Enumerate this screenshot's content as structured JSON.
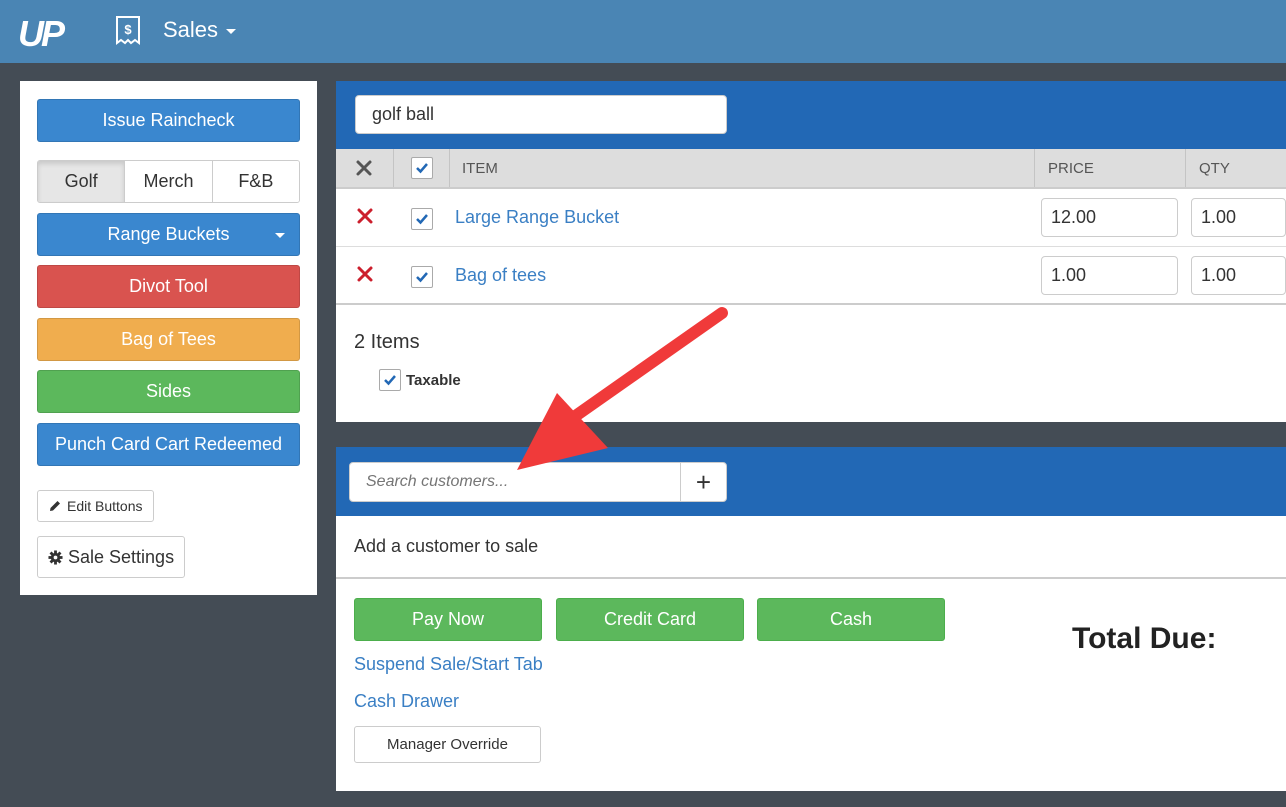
{
  "header": {
    "app_logo_text": "UP",
    "menu_label": "Sales"
  },
  "left_panel": {
    "issue_raincheck": "Issue Raincheck",
    "categories": [
      {
        "label": "Golf",
        "active": true
      },
      {
        "label": "Merch",
        "active": false
      },
      {
        "label": "F&B",
        "active": false
      }
    ],
    "quick_buttons": {
      "range_buckets": "Range Buckets",
      "divot_tool": "Divot Tool",
      "bag_of_tees": "Bag of Tees",
      "sides": "Sides",
      "punch_card": "Punch Card Cart Redeemed"
    },
    "edit_buttons": "Edit Buttons",
    "sale_settings": "Sale Settings"
  },
  "cart": {
    "search_value": "golf ball",
    "columns": {
      "item": "ITEM",
      "price": "PRICE",
      "qty": "QTY"
    },
    "rows": [
      {
        "item": "Large Range Bucket",
        "price": "12.00",
        "qty": "1.00",
        "checked": true
      },
      {
        "item": "Bag of tees",
        "price": "1.00",
        "qty": "1.00",
        "checked": true
      }
    ],
    "items_count": "2 Items",
    "taxable_label": "Taxable"
  },
  "customer": {
    "search_placeholder": "Search customers...",
    "add_symbol": "+",
    "empty_text": "Add a customer to sale"
  },
  "payment": {
    "pay_now": "Pay Now",
    "credit_card": "Credit Card",
    "cash": "Cash",
    "suspend_sale": "Suspend Sale/Start Tab",
    "cash_drawer": "Cash Drawer",
    "manager_override": "Manager Override",
    "total_due_label": "Total Due:"
  },
  "colors": {
    "header": "#4a85b4",
    "primary": "#2268b5",
    "danger": "#d9534f",
    "warning": "#f0ad4e",
    "success": "#5cb85c",
    "annotation_arrow": "#f03a3a"
  }
}
